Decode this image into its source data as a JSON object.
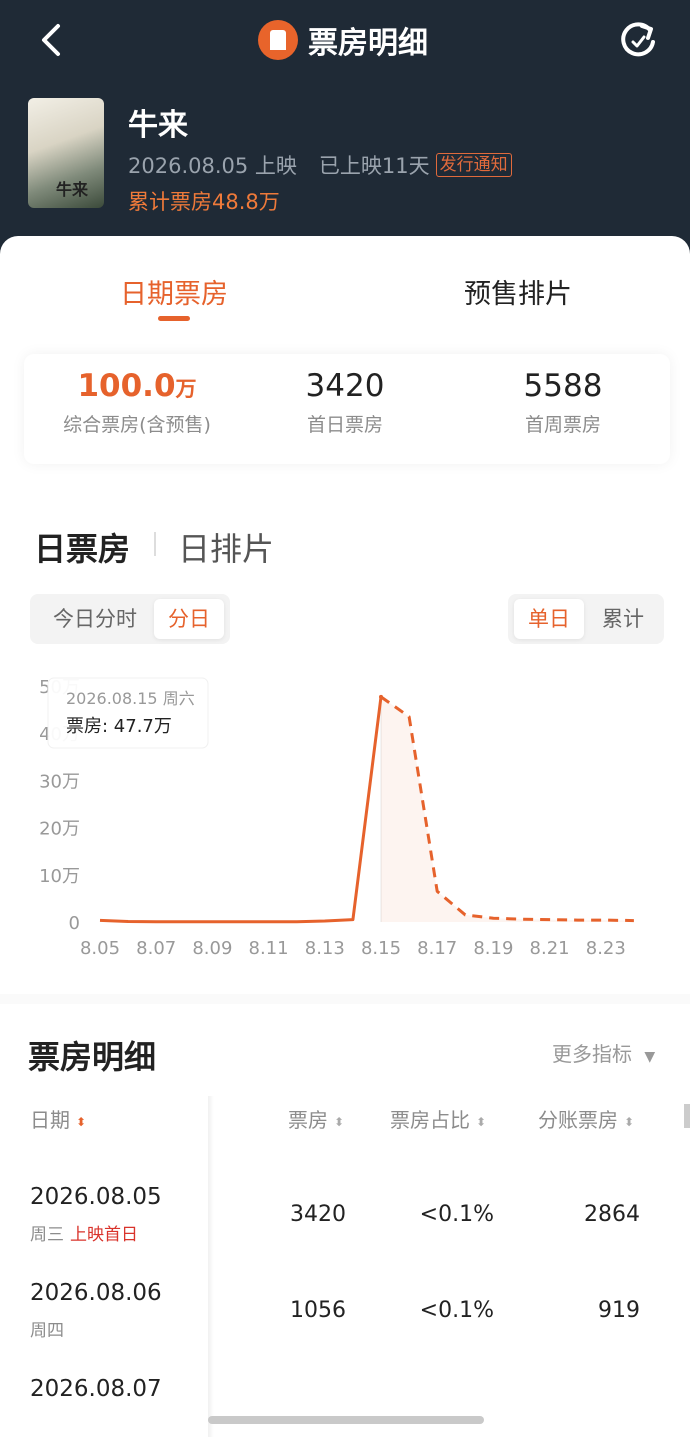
{
  "nav": {
    "back_icon": "chevron-left-icon",
    "title": "票房明细",
    "logo_icon": "app-logo-icon",
    "refresh_icon": "refresh-icon"
  },
  "movie": {
    "poster_text": "牛来",
    "name": "牛来",
    "release_date": "2026.08.05 上映",
    "days_showing": "已上映11天",
    "notice_badge": "发行通知",
    "cumulative_box": "累计票房48.8万"
  },
  "tabs": {
    "active": "日期票房",
    "inactive": "预售排片"
  },
  "stats": [
    {
      "value": "100.0",
      "unit": "万",
      "label": "综合票房(含预售)"
    },
    {
      "value": "3420",
      "unit": "",
      "label": "首日票房"
    },
    {
      "value": "5588",
      "unit": "",
      "label": "首周票房"
    }
  ],
  "section": {
    "title": "日票房",
    "alt_title": "日排片"
  },
  "segments": {
    "left": [
      "今日分时",
      "分日"
    ],
    "right": [
      "单日",
      "累计"
    ]
  },
  "tooltip": {
    "date": "2026.08.15 周六",
    "value": "票房: 47.7万"
  },
  "chart_data": {
    "type": "line",
    "x": [
      "8.05",
      "8.06",
      "8.07",
      "8.08",
      "8.09",
      "8.10",
      "8.11",
      "8.12",
      "8.13",
      "8.14",
      "8.15",
      "8.16",
      "8.17",
      "8.18",
      "8.19",
      "8.20",
      "8.21",
      "8.22",
      "8.23",
      "8.24"
    ],
    "x_tick_labels": [
      "8.05",
      "8.07",
      "8.09",
      "8.11",
      "8.13",
      "8.15",
      "8.17",
      "8.19",
      "8.21",
      "8.23"
    ],
    "series": [
      {
        "values": [
          0.34,
          0.11,
          0.06,
          0.05,
          0.05,
          0.05,
          0.05,
          0.06,
          0.2,
          0.5,
          47.7,
          43.5,
          6.5,
          1.5,
          0.8,
          0.6,
          0.5,
          0.4,
          0.4,
          0.3
        ]
      }
    ],
    "solid_until_index": 10,
    "y_tick_labels": [
      "0",
      "10万",
      "20万",
      "30万",
      "40万",
      "50万"
    ],
    "y_ticks": [
      0,
      10,
      20,
      30,
      40,
      50
    ],
    "ylim": [
      0,
      50
    ],
    "highlight_index": 10,
    "line_color": "#e6622c",
    "grid": false
  },
  "table": {
    "title": "票房明细",
    "more": "更多指标",
    "headers": [
      "日期",
      "票房",
      "票房占比",
      "分账票房"
    ],
    "rows": [
      {
        "date": "2026.08.05",
        "weekday": "周三",
        "tag": "上映首日",
        "box": "3420",
        "share": "<0.1%",
        "split": "2864"
      },
      {
        "date": "2026.08.06",
        "weekday": "周四",
        "tag": "",
        "box": "1056",
        "share": "<0.1%",
        "split": "919"
      },
      {
        "date": "2026.08.07",
        "weekday": "",
        "tag": "",
        "box": "",
        "share": "",
        "split": ""
      }
    ]
  }
}
